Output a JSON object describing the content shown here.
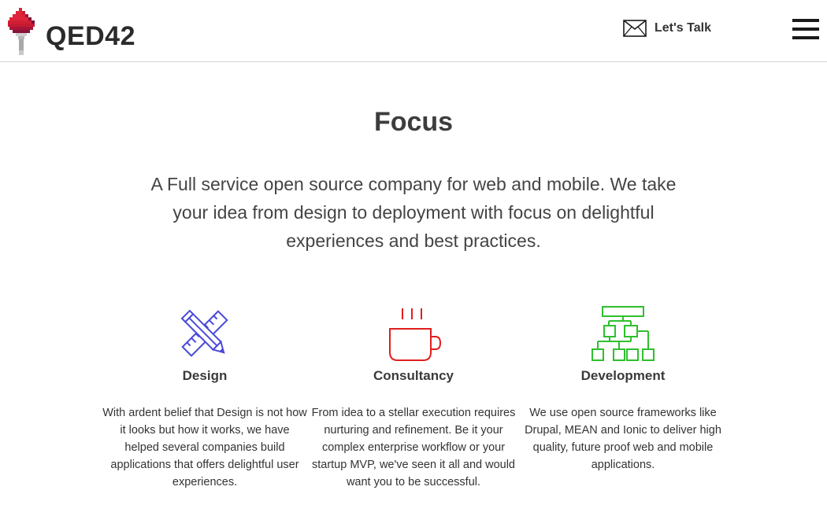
{
  "header": {
    "logo_text": "QED42",
    "contact_label": "Let's Talk"
  },
  "main": {
    "title": "Focus",
    "intro": "A Full service open source company for web and mobile. We take your idea from design to deployment with focus on delightful experiences and best practices.",
    "services": [
      {
        "title": "Design",
        "text": "With ardent belief that Design is not how it looks but how it works, we have helped several companies build applications that offers delightful user experiences.",
        "icon": "pencil-ruler-icon",
        "color": "#4a4ad8"
      },
      {
        "title": "Consultancy",
        "text": "From idea to a stellar execution requires nurturing and refinement. Be it your complex enterprise workflow or your startup MVP, we've seen it all and would want you to be successful.",
        "icon": "coffee-cup-icon",
        "color": "#e01e1e"
      },
      {
        "title": "Development",
        "text": "We use open source frameworks like Drupal, MEAN and Ionic to deliver high quality, future proof web and mobile applications.",
        "icon": "flowchart-icon",
        "color": "#2fbf2f"
      }
    ]
  }
}
